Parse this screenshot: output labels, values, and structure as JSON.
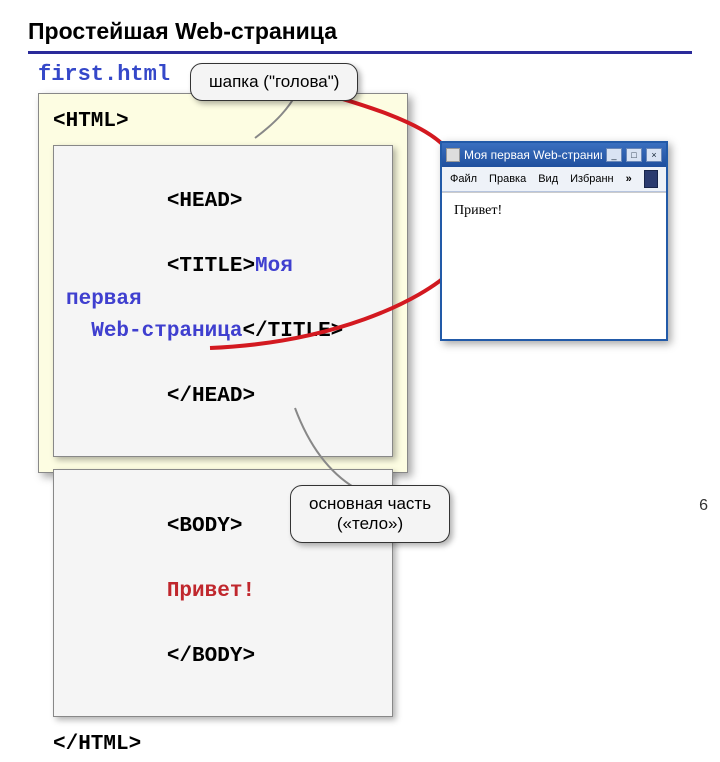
{
  "title": "Простейшая Web-страница",
  "filename": "first.html",
  "code": {
    "html_open": "<HTML>",
    "head_open": "<HEAD>",
    "title_open": "<TITLE>",
    "title_text": "Моя первая\n  Web-страница",
    "title_close": "</TITLE>",
    "head_close": "</HEAD>",
    "body_open": "<BODY>",
    "body_content": "Привет!",
    "body_close": "</BODY>",
    "html_close": "</HTML>"
  },
  "callouts": {
    "head": "шапка (\"голова\")",
    "body_l1": "основная часть",
    "body_l2": "(«тело»)"
  },
  "browser": {
    "title": "Моя первая Web-страница ...",
    "menu": {
      "file": "Файл",
      "edit": "Правка",
      "view": "Вид",
      "fav": "Избранн",
      "more": "»"
    },
    "win": {
      "min": "_",
      "max": "□",
      "close": "×"
    },
    "content": "Привет!"
  },
  "page_number": "6"
}
